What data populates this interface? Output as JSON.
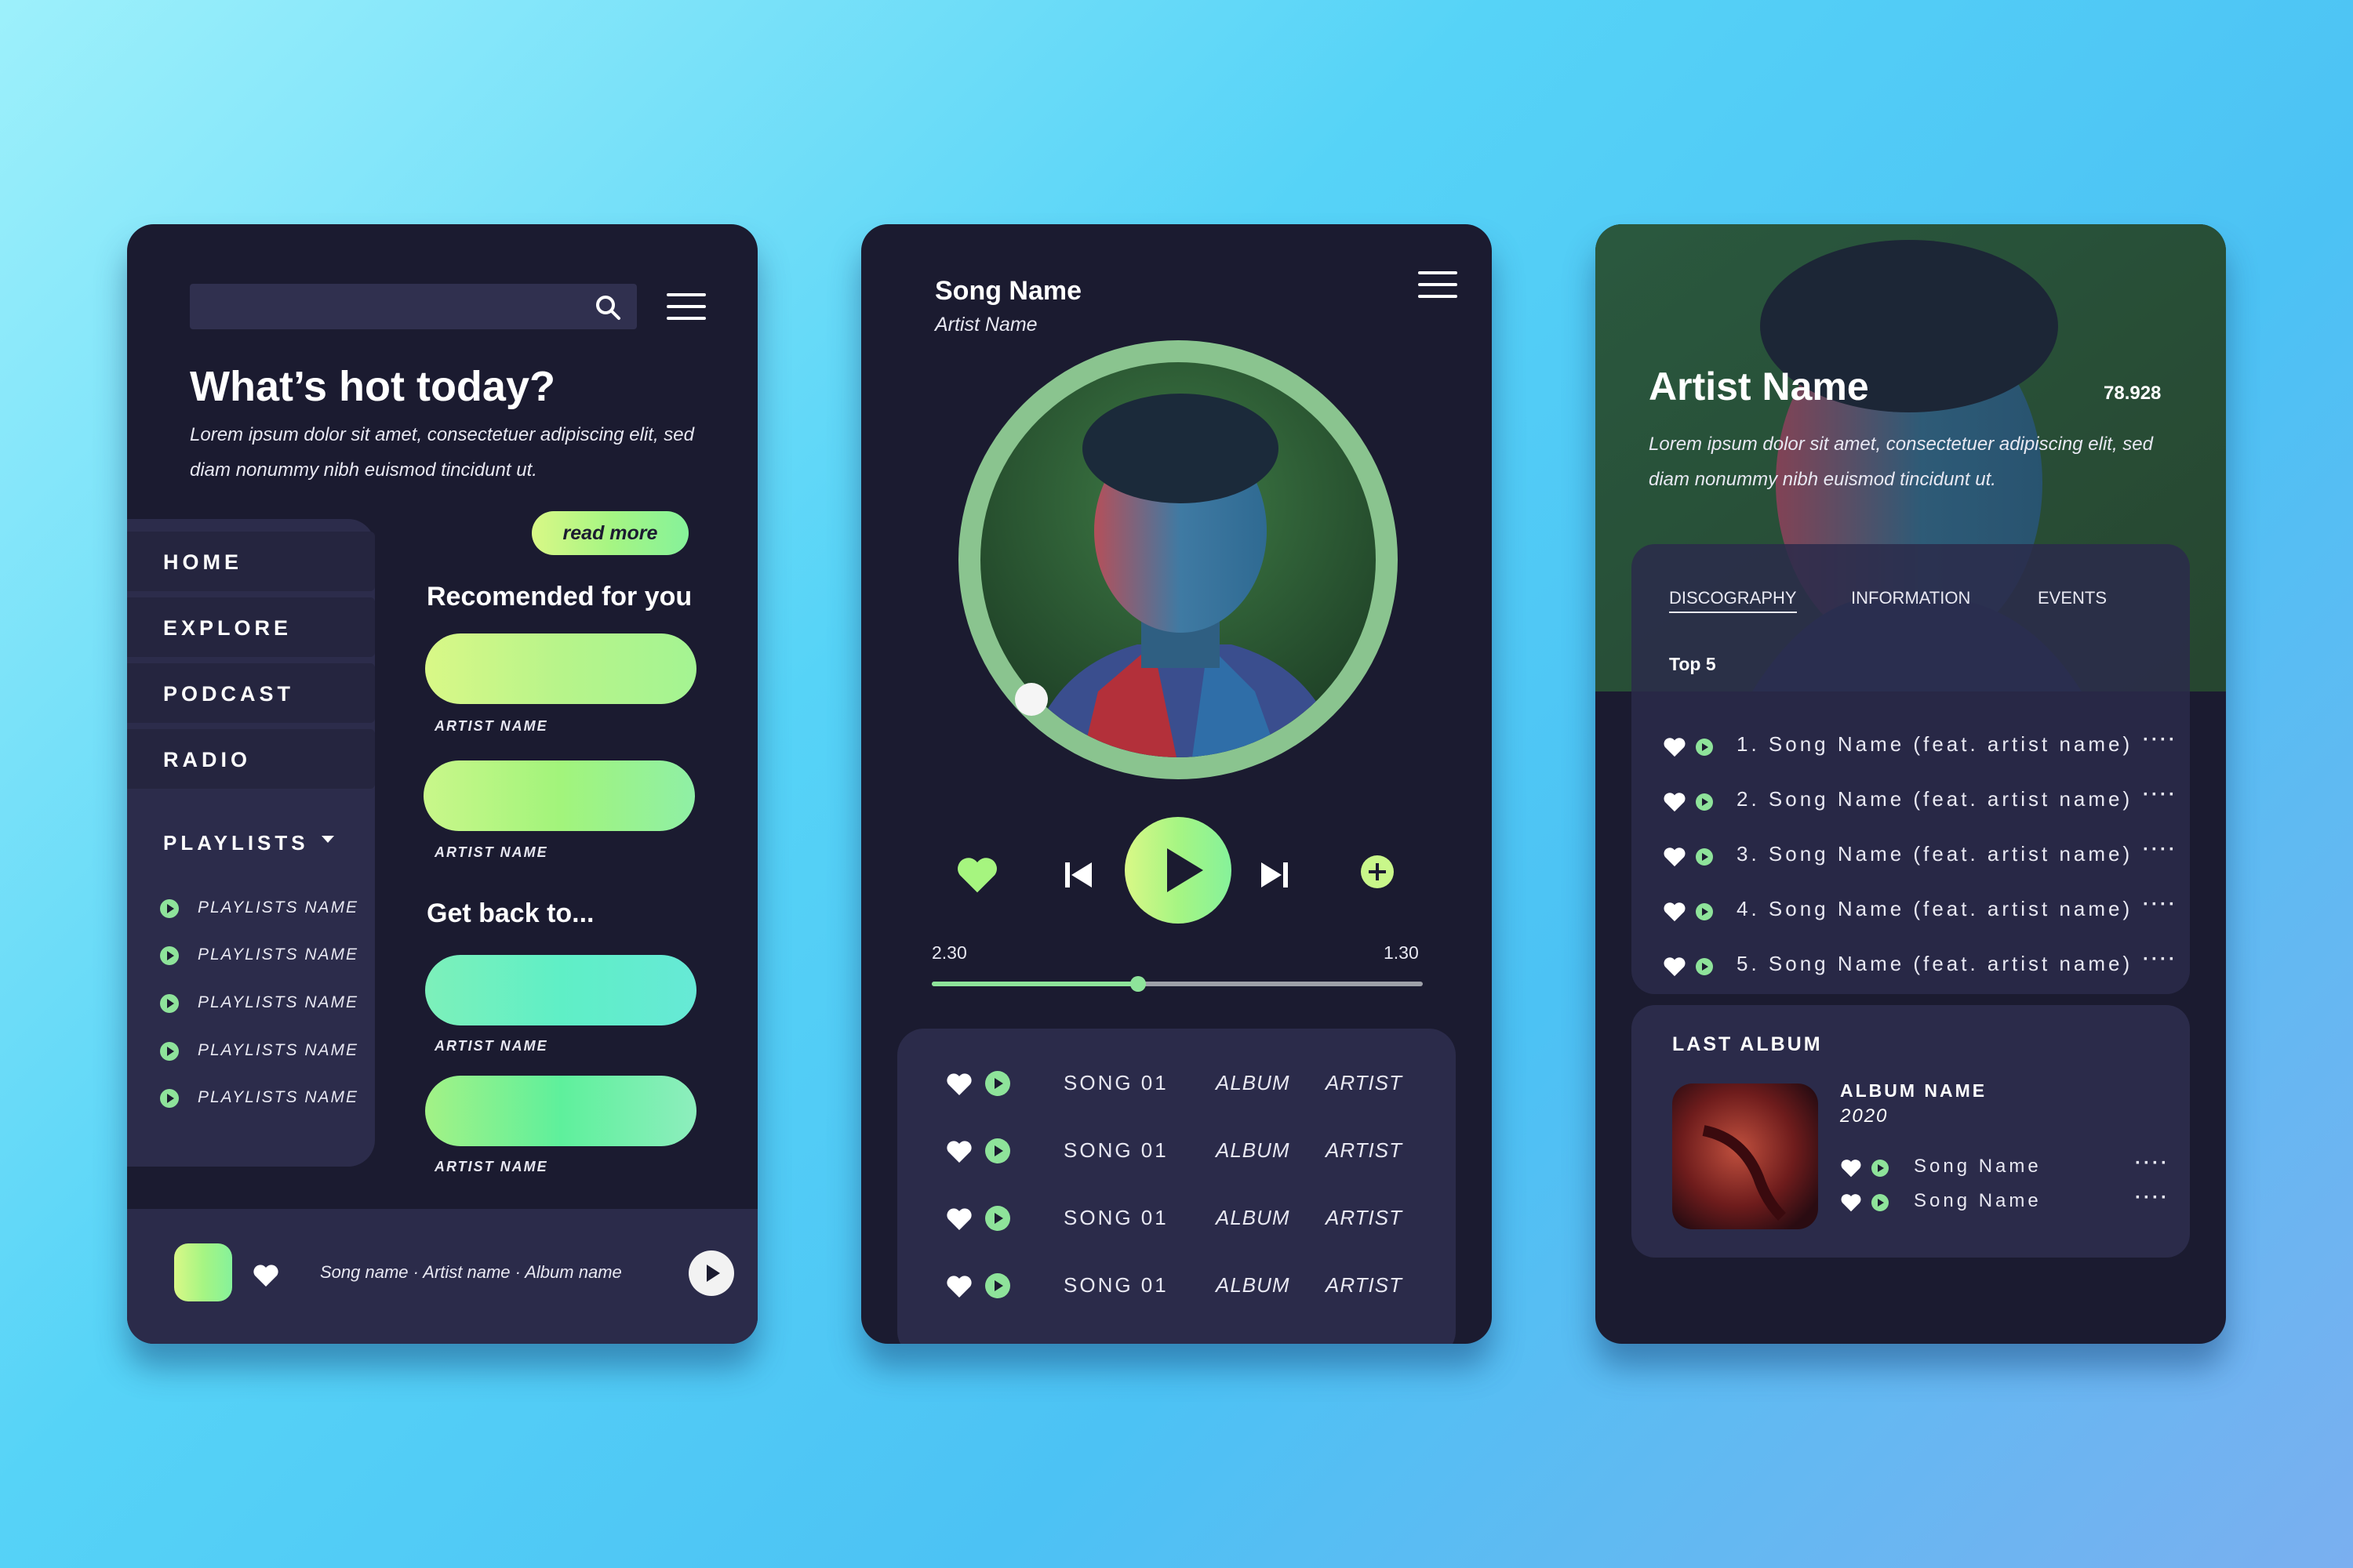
{
  "colors": {
    "background_start": "#9df0fb",
    "background_end": "#7aaff0",
    "card": "#1b1b30",
    "panel": "#2b2b4a",
    "accent": "#8ee39a",
    "accent_lime": "#d9f887"
  },
  "home": {
    "search_placeholder": "",
    "title": "What’s hot today?",
    "description": "Lorem ipsum dolor sit amet, consectetuer adipiscing elit, sed diam nonummy nibh euismod tincidunt ut.",
    "read_more": "read more",
    "nav": [
      "HOME",
      "EXPLORE",
      "PODCAST",
      "RADIO"
    ],
    "playlists_header": "PLAYLISTS",
    "playlists": [
      "PLAYLISTS NAME",
      "PLAYLISTS NAME",
      "PLAYLISTS NAME",
      "PLAYLISTS NAME",
      "PLAYLISTS NAME"
    ],
    "recommended_title": "Recomended for you",
    "recommended": [
      "ARTIST NAME",
      "ARTIST NAME"
    ],
    "getback_title": "Get back to...",
    "getback": [
      "ARTIST NAME",
      "ARTIST NAME"
    ],
    "now_playing": "Song name · Artist name · Album name"
  },
  "player": {
    "song_name": "Song Name",
    "artist_name": "Artist Name",
    "time_elapsed": "2.30",
    "time_total": "1.30",
    "progress_percent": 42,
    "songs": [
      {
        "song": "SONG 01",
        "album": "ALBUM",
        "artist": "ARTIST"
      },
      {
        "song": "SONG 01",
        "album": "ALBUM",
        "artist": "ARTIST"
      },
      {
        "song": "SONG 01",
        "album": "ALBUM",
        "artist": "ARTIST"
      },
      {
        "song": "SONG 01",
        "album": "ALBUM",
        "artist": "ARTIST"
      }
    ]
  },
  "artist": {
    "name": "Artist Name",
    "count": "78.928",
    "description": "Lorem ipsum dolor sit amet, consectetuer adipiscing elit, sed diam nonummy nibh euismod tincidunt ut.",
    "tabs": [
      "DISCOGRAPHY",
      "INFORMATION",
      "EVENTS"
    ],
    "top_label": "Top 5",
    "top_songs": [
      "1. Song Name (feat. artist name)",
      "2. Song Name (feat. artist name)",
      "3. Song Name (feat. artist name)",
      "4. Song Name (feat. artist name)",
      "5. Song Name (feat. artist name)"
    ],
    "more_glyph": "····",
    "last_album_title": "LAST ALBUM",
    "album_name": "ALBUM NAME",
    "album_year": "2020",
    "album_songs": [
      "Song Name",
      "Song Name"
    ]
  }
}
